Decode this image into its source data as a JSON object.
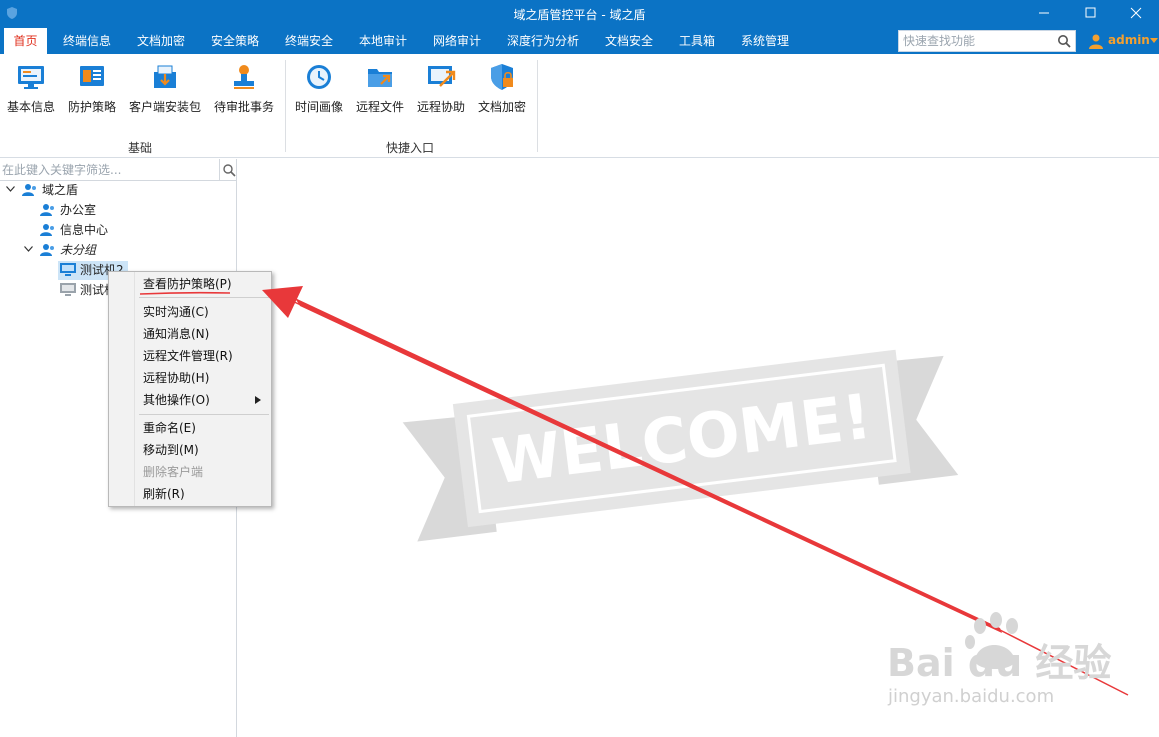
{
  "window": {
    "title": "域之盾管控平台 - 域之盾"
  },
  "menu": {
    "items": [
      "首页",
      "终端信息",
      "文档加密",
      "安全策略",
      "终端安全",
      "本地审计",
      "网络审计",
      "深度行为分析",
      "文档安全",
      "工具箱",
      "系统管理"
    ],
    "active_index": 0
  },
  "search": {
    "placeholder": "快速查找功能"
  },
  "user": {
    "name": "admin"
  },
  "ribbon": {
    "groups": [
      {
        "label": "基础",
        "tools": [
          "基本信息",
          "防护策略",
          "客户端安装包",
          "待审批事务"
        ]
      },
      {
        "label": "快捷入口",
        "tools": [
          "时间画像",
          "远程文件",
          "远程协助",
          "文档加密"
        ]
      }
    ]
  },
  "tree": {
    "filter_placeholder": "在此键入关键字筛选...",
    "nodes": [
      {
        "label": "域之盾",
        "italic": false
      },
      {
        "label": "办公室",
        "italic": false
      },
      {
        "label": "信息中心",
        "italic": false
      },
      {
        "label": "未分组",
        "italic": true
      },
      {
        "label": "测试机2",
        "italic": false
      },
      {
        "label": "测试机",
        "italic": false
      }
    ]
  },
  "context_menu": {
    "items": [
      {
        "label": "查看防护策略(P)",
        "enabled": true
      },
      {
        "label": "实时沟通(C)",
        "enabled": true
      },
      {
        "label": "通知消息(N)",
        "enabled": true
      },
      {
        "label": "远程文件管理(R)",
        "enabled": true
      },
      {
        "label": "远程协助(H)",
        "enabled": true
      },
      {
        "label": "其他操作(O)",
        "enabled": true,
        "submenu": true
      },
      {
        "label": "重命名(E)",
        "enabled": true
      },
      {
        "label": "移动到(M)",
        "enabled": true
      },
      {
        "label": "删除客户端",
        "enabled": false
      },
      {
        "label": "刷新(R)",
        "enabled": true
      }
    ]
  },
  "welcome": {
    "text": "WELCOME!"
  },
  "watermark": {
    "brand": "Bai du 经验",
    "url": "jingyan.baidu.com"
  },
  "colors": {
    "titlebar": "#0b73c5",
    "accent_red": "#e0301e",
    "user_orange": "#f3a030",
    "icon_blue": "#1a7fd6",
    "icon_orange": "#f08a1c",
    "annotation_red": "#e8383a"
  }
}
